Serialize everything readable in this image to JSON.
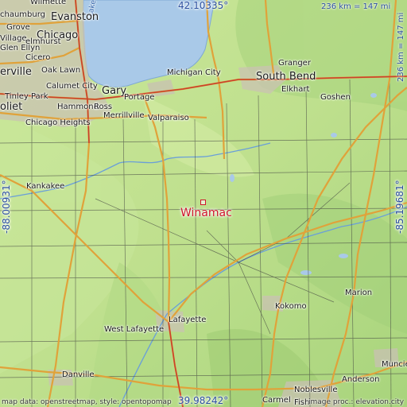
{
  "map": {
    "featured_city": "Winamac",
    "coords": {
      "north": "42.10335°",
      "south": "39.98242°",
      "west": "-88.00931°",
      "east": "-85.19681°"
    },
    "scale": {
      "horizontal": "236 km = 147 mi",
      "vertical": "236 km = 147 mi"
    },
    "credit_left": "map data: openstreetmap, style: opentopomap",
    "credit_right": "image proc.: elevation.city",
    "places": {
      "wilmette": "Wilmette",
      "evanston": "Evanston",
      "lake_michigan": "Lake Michigan",
      "schaumburg": "chaumburg",
      "grove": "Grove",
      "chicago": "Chicago",
      "village": "Village",
      "elmhurst": "elmhurst",
      "glen_ellyn": "Glen Ellyn",
      "cicero": "Cicero",
      "naperville": "erville",
      "oak_lawn": "Oak Lawn",
      "calumet_city": "Calumet City",
      "tinley_park": "Tinley Park",
      "joliet": "oliet",
      "hammond": "Hammond",
      "ross": "Ross",
      "gary": "Gary",
      "portage": "Portage",
      "chicago_heights": "Chicago Heights",
      "merrillville": "Merrillville",
      "valparaiso": "Valparaiso",
      "michigan_city": "Michigan City",
      "granger": "Granger",
      "south_bend": "South Bend",
      "elkhart": "Elkhart",
      "goshen": "Goshen",
      "kankakee": "Kankakee",
      "kokomo": "Kokomo",
      "marion": "Marion",
      "west_lafayette": "West Lafayette",
      "lafayette": "Lafayette",
      "danville": "Danville",
      "muncie": "Muncie",
      "noblesville": "Noblesville",
      "anderson": "Anderson",
      "carmel": "Carmel",
      "fishers": "Fish"
    },
    "colors": {
      "water": "#a9c9e8",
      "land_light": "#d2ea9f",
      "land_mid": "#b7dc87",
      "land_dark": "#9ccb73",
      "major_road": "#e0a23a",
      "minor_road": "#333333",
      "marker": "#d0152b"
    }
  }
}
